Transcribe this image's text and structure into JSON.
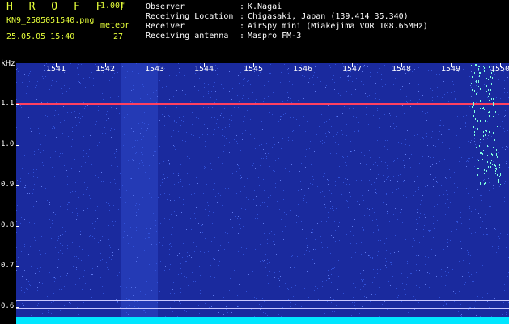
{
  "header": {
    "title": "H R O F F T",
    "version": "1.00f",
    "filename": "KN9_2505051540.png",
    "meteor_label": "meteor",
    "timestamp": "25.05.05 15:40",
    "meteor_count": "27",
    "info": [
      {
        "label": "Observer",
        "value": "K.Nagai"
      },
      {
        "label": "Receiving Location",
        "value": "Chigasaki, Japan (139.414 35.340)"
      },
      {
        "label": "Receiver",
        "value": "AirSpy mini (Miakejima VOR 108.65MHz)"
      },
      {
        "label": "Receiving antenna",
        "value": "Maspro FM-3"
      }
    ],
    "separator": ":"
  },
  "spectrogram": {
    "y_unit": "kHz",
    "y_ticks": [
      "1.1",
      "1.0",
      "0.9",
      "0.8",
      "0.7",
      "0.6"
    ],
    "x_ticks": [
      "1541",
      "1542",
      "1543",
      "1544",
      "1545",
      "1546",
      "1547",
      "1548",
      "1549",
      "1550"
    ],
    "colors": {
      "background": "#1a2a9e",
      "noise": "#2f4fd6",
      "carrier": "#ff4060",
      "floor": "#00e6ff",
      "text": "#e6ff3a"
    }
  }
}
